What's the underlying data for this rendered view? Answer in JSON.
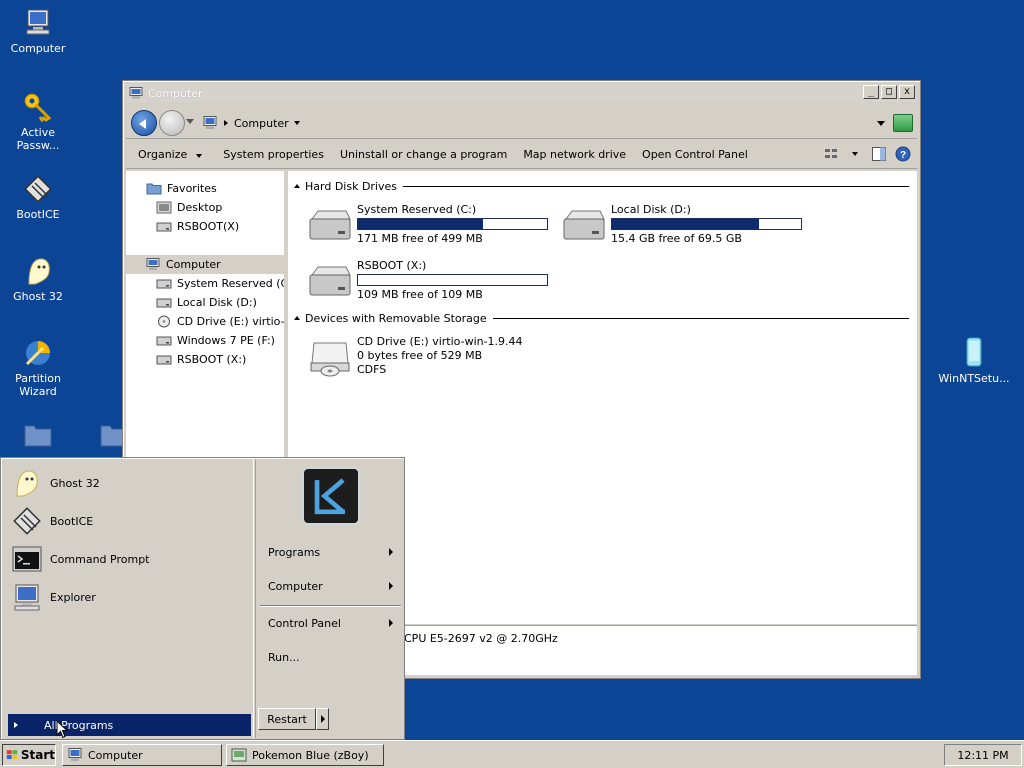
{
  "desktop": {
    "background_color": "#0d4596",
    "icons": [
      {
        "label": "Computer",
        "icon": "computer-icon"
      },
      {
        "label": "Active Passw...",
        "icon": "key-icon"
      },
      {
        "label": "BootICE",
        "icon": "bootice-icon"
      },
      {
        "label": "Ghost 32",
        "icon": "ghost-icon"
      },
      {
        "label": "Partition Wizard",
        "icon": "partition-wizard-icon"
      },
      {
        "label": "WinNTSetu...",
        "icon": "winntsetup-icon"
      }
    ]
  },
  "window": {
    "title": "Computer",
    "controls": {
      "minimize": "_",
      "maximize": "□",
      "close": "x"
    },
    "address": {
      "crumb": "Computer"
    },
    "commands": [
      "Organize",
      "System properties",
      "Uninstall or change a program",
      "Map network drive",
      "Open Control Panel"
    ],
    "nav": {
      "favorites": "Favorites",
      "favorite_items": [
        "Desktop",
        "RSBOOT(X)"
      ],
      "computer": "Computer",
      "computer_items": [
        "System Reserved (C:)",
        "Local Disk (D:)",
        "CD Drive (E:) virtio-win",
        "Windows 7 PE (F:)",
        "RSBOOT (X:)"
      ]
    },
    "groups": {
      "hard_disks": "Hard Disk Drives",
      "removable": "Devices with Removable Storage"
    },
    "drives": [
      {
        "name": "System Reserved (C:)",
        "free_text": "171 MB free of 499 MB",
        "used_fraction": 0.66
      },
      {
        "name": "Local Disk (D:)",
        "free_text": "15.4 GB free of 69.5 GB",
        "used_fraction": 0.78
      },
      {
        "name": "RSBOOT (X:)",
        "free_text": "109 MB free of 109 MB",
        "used_fraction": 0.0
      }
    ],
    "cd_drive": {
      "name": "CD Drive (E:) virtio-win-1.9.44",
      "free_text": "0 bytes free of 529 MB",
      "fs": "CDFS"
    },
    "details": "CPU E5-2697 v2 @ 2.70GHz"
  },
  "start_menu": {
    "pinned": [
      {
        "label": "Ghost 32",
        "icon": "ghost-icon"
      },
      {
        "label": "BootICE",
        "icon": "bootice-icon"
      },
      {
        "label": "Command Prompt",
        "icon": "command-prompt-icon"
      },
      {
        "label": "Explorer",
        "icon": "explorer-icon"
      }
    ],
    "all_programs": "All Programs",
    "right_items": [
      "Programs",
      "Computer",
      "Control Panel",
      "Run..."
    ],
    "restart": "Restart"
  },
  "taskbar": {
    "start": "Start",
    "tasks": [
      "Computer",
      "Pokemon Blue (zBoy)"
    ],
    "clock": "12:11 PM"
  },
  "colors": {
    "selection": "#0a246a",
    "disk_bar_fill": "#0e2b6e",
    "face": "#d4d0c8"
  }
}
